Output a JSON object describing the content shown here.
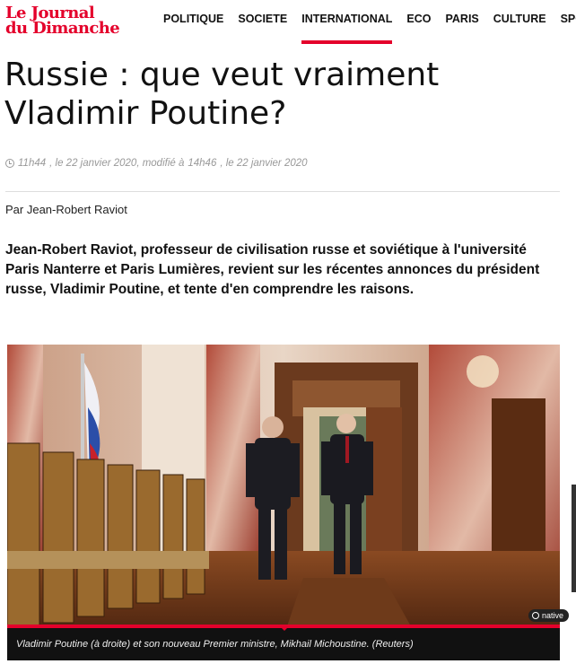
{
  "header": {
    "logo_line1": "Le Journal",
    "logo_line2": "du Dimanche",
    "nav": [
      "POLITIQUE",
      "SOCIETE",
      "INTERNATIONAL",
      "ECO",
      "PARIS",
      "CULTURE",
      "SPORT"
    ],
    "active_nav": "INTERNATIONAL"
  },
  "article": {
    "title": "Russie : que veut vraiment Vladimir Poutine?",
    "meta": {
      "time": "11h44",
      "date_text": ", le 22 janvier 2020, modifié à",
      "modified_time": "14h46",
      "modified_date": ", le 22 janvier 2020"
    },
    "byline": "Par Jean-Robert Raviot",
    "lead": "Jean-Robert Raviot, professeur de civilisation russe et soviétique à l'université Paris Nanterre et Paris Lumières, revient sur les récentes annonces du président russe, Vladimir Poutine, et tente d'en comprendre les raisons."
  },
  "photo": {
    "caption": "Vladimir Poutine (à droite) et son nouveau Premier ministre, Mikhail Michoustine. (Reuters)",
    "badge": "native"
  },
  "colors": {
    "brand": "#e4002b"
  }
}
